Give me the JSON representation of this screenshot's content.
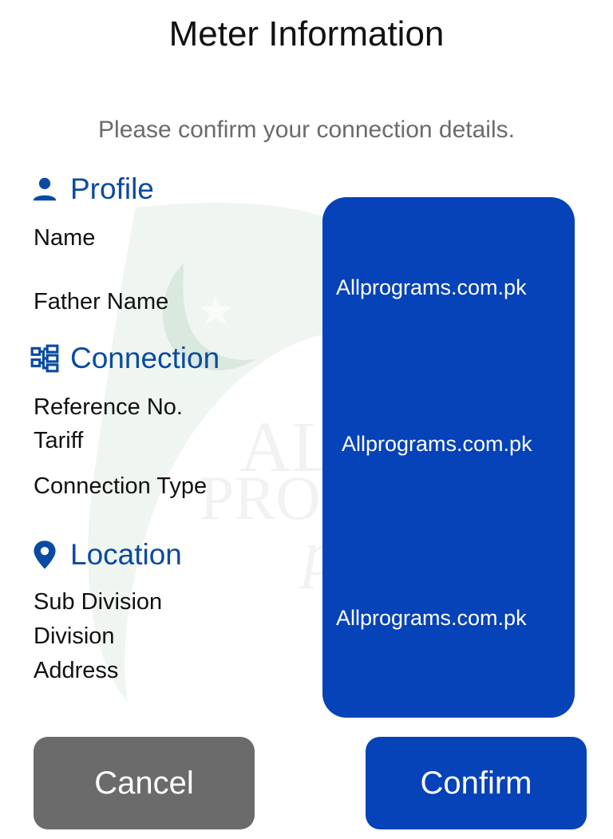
{
  "header": {
    "title": "Meter Information",
    "subtitle": "Please confirm your connection details."
  },
  "sections": {
    "profile": {
      "title": "Profile",
      "icon": "person-icon",
      "labels": [
        "Name",
        "Father Name"
      ]
    },
    "connection": {
      "title": "Connection",
      "icon": "hierarchy-icon",
      "labels": [
        "Reference No.",
        "Tariff",
        "Connection Type"
      ]
    },
    "location": {
      "title": "Location",
      "icon": "location-pin-icon",
      "labels": [
        "Sub Division",
        "Division",
        "Address"
      ]
    }
  },
  "panel": {
    "values": [
      "Allprograms.com.pk",
      "Allprograms.com.pk",
      "Allprograms.com.pk"
    ]
  },
  "watermark": {
    "line1": "ALL",
    "line2": "PROGRAMS",
    "line3": "pakistan"
  },
  "buttons": {
    "cancel": "Cancel",
    "confirm": "Confirm"
  },
  "colors": {
    "accent": "#0642b8",
    "section_title": "#0b4aa2",
    "cancel": "#6b6b6b"
  }
}
